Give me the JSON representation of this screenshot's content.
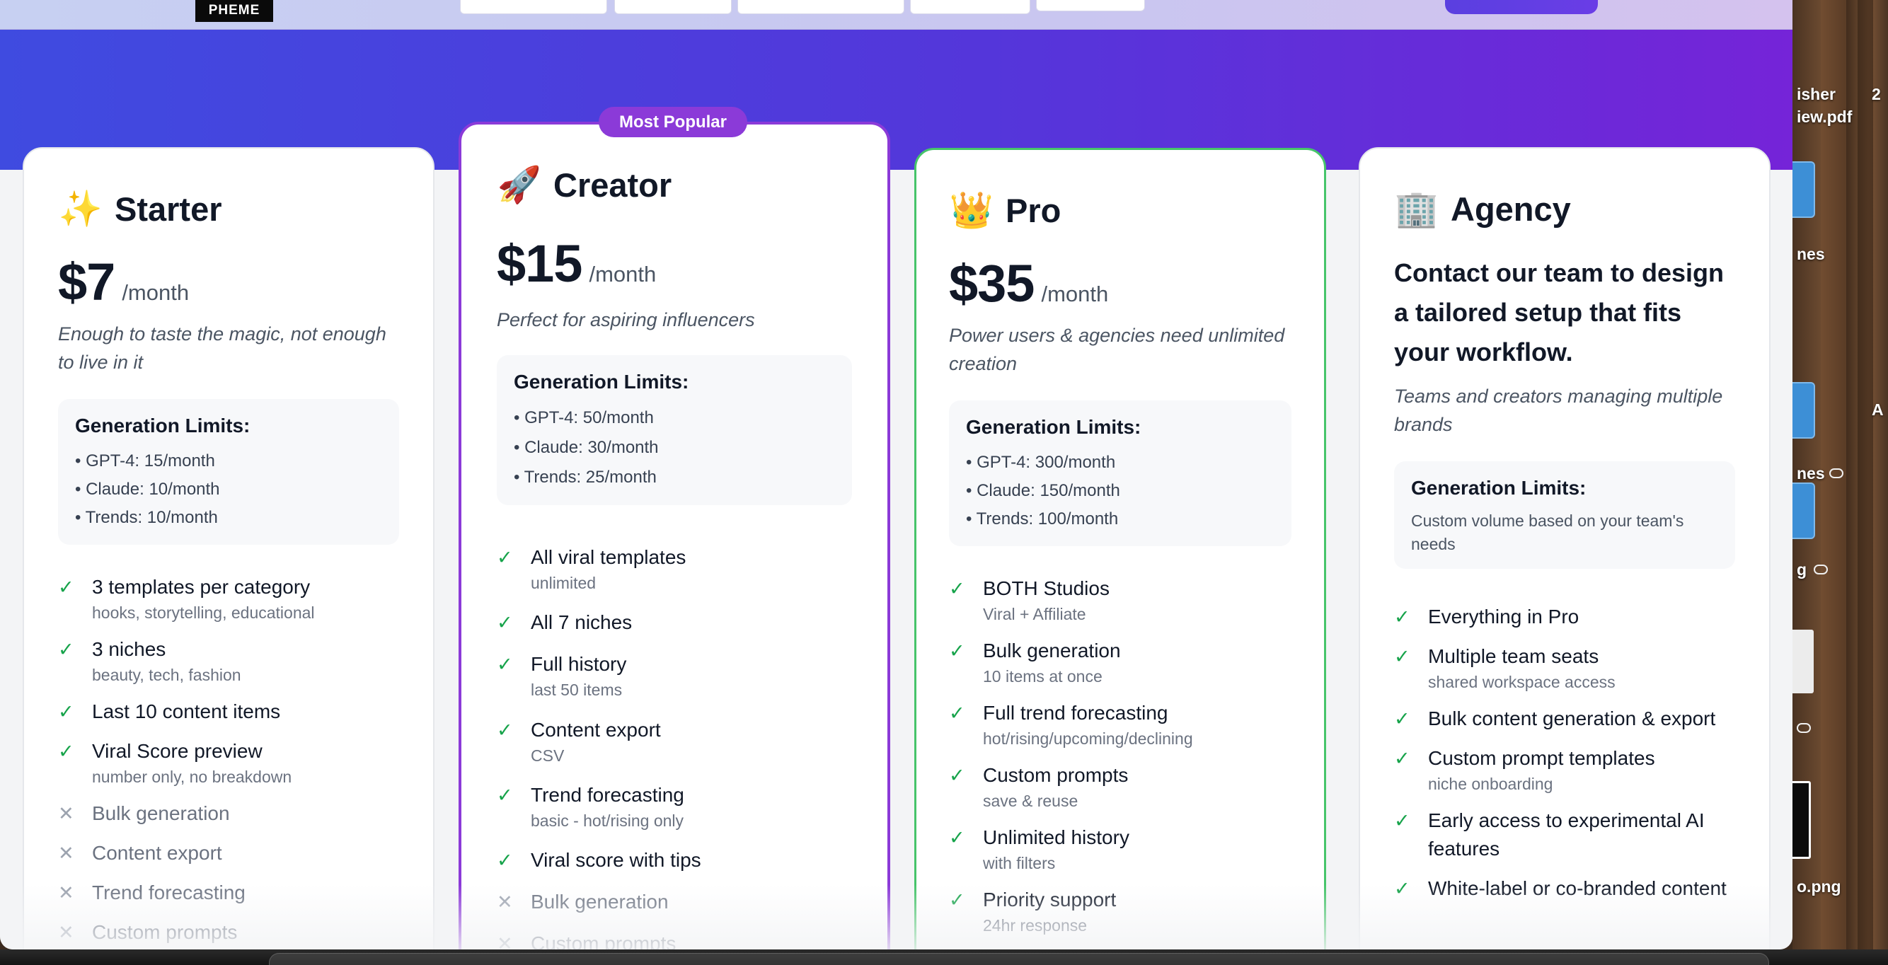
{
  "nav": {
    "logo_text": "PHEME"
  },
  "badge": {
    "most_popular": "Most Popular"
  },
  "plans": [
    {
      "emoji": "✨",
      "name": "Starter",
      "price": "$7",
      "period": "/month",
      "tagline": "Enough to taste the magic, not enough to live in it",
      "limits_title": "Generation Limits:",
      "limits": [
        "• GPT-4: 15/month",
        "• Claude: 10/month",
        "• Trends: 10/month"
      ],
      "features": [
        {
          "label": "3 templates per category",
          "sub": "hooks, storytelling, educational",
          "included": true
        },
        {
          "label": "3 niches",
          "sub": "beauty, tech, fashion",
          "included": true
        },
        {
          "label": "Last 10 content items",
          "sub": "",
          "included": true
        },
        {
          "label": "Viral Score preview",
          "sub": "number only, no breakdown",
          "included": true
        },
        {
          "label": "Bulk generation",
          "sub": "",
          "included": false
        },
        {
          "label": "Content export",
          "sub": "",
          "included": false
        },
        {
          "label": "Trend forecasting",
          "sub": "",
          "included": false
        },
        {
          "label": "Custom prompts",
          "sub": "",
          "included": false
        }
      ]
    },
    {
      "emoji": "🚀",
      "name": "Creator",
      "price": "$15",
      "period": "/month",
      "tagline": "Perfect for aspiring influencers",
      "limits_title": "Generation Limits:",
      "limits": [
        "• GPT-4: 50/month",
        "• Claude: 30/month",
        "• Trends: 25/month"
      ],
      "features": [
        {
          "label": "All viral templates",
          "sub": "unlimited",
          "included": true
        },
        {
          "label": "All 7 niches",
          "sub": "",
          "included": true
        },
        {
          "label": "Full history",
          "sub": "last 50 items",
          "included": true
        },
        {
          "label": "Content export",
          "sub": "CSV",
          "included": true
        },
        {
          "label": "Trend forecasting",
          "sub": "basic - hot/rising only",
          "included": true
        },
        {
          "label": "Viral score with tips",
          "sub": "",
          "included": true
        },
        {
          "label": "Bulk generation",
          "sub": "",
          "included": false
        },
        {
          "label": "Custom prompts",
          "sub": "",
          "included": false
        }
      ]
    },
    {
      "emoji": "👑",
      "name": "Pro",
      "price": "$35",
      "period": "/month",
      "tagline": "Power users & agencies need unlimited creation",
      "limits_title": "Generation Limits:",
      "limits": [
        "• GPT-4: 300/month",
        "• Claude: 150/month",
        "• Trends: 100/month"
      ],
      "features": [
        {
          "label": "BOTH Studios",
          "sub": "Viral + Affiliate",
          "included": true
        },
        {
          "label": "Bulk generation",
          "sub": "10 items at once",
          "included": true
        },
        {
          "label": "Full trend forecasting",
          "sub": "hot/rising/upcoming/declining",
          "included": true
        },
        {
          "label": "Custom prompts",
          "sub": "save & reuse",
          "included": true
        },
        {
          "label": "Unlimited history",
          "sub": "with filters",
          "included": true
        },
        {
          "label": "Priority support",
          "sub": "24hr response",
          "included": true
        }
      ]
    },
    {
      "emoji": "🏢",
      "name": "Agency",
      "headline": "Contact our team to design a tailored setup that fits your workflow.",
      "tagline": "Teams and creators managing multiple brands",
      "limits_title": "Generation Limits:",
      "limits_note": "Custom volume based on your team's needs",
      "features": [
        {
          "label": "Everything in Pro",
          "sub": "",
          "included": true
        },
        {
          "label": "Multiple team seats",
          "sub": "shared workspace access",
          "included": true
        },
        {
          "label": "Bulk content generation & export",
          "sub": "",
          "included": true
        },
        {
          "label": "Custom prompt templates",
          "sub": "niche onboarding",
          "included": true
        },
        {
          "label": "Early access to experimental AI features",
          "sub": "",
          "included": true
        },
        {
          "label": "White-label or co-branded content",
          "sub": "",
          "included": true
        }
      ]
    }
  ],
  "desktop": {
    "file1": "isher",
    "file1b": "iew.pdf",
    "file2": "nes",
    "file3": "nes",
    "file4": "g",
    "file5": "o.png",
    "edge1": "2",
    "edge2": "A"
  },
  "icons": {
    "check": "check-icon",
    "cross": "x-icon",
    "accent_purple": "#8b3ad8",
    "accent_green": "#46c46a",
    "hero_gradient": [
      "#3f4be0",
      "#7524d8"
    ]
  }
}
